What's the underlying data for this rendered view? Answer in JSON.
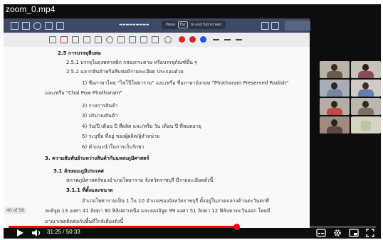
{
  "player": {
    "title": "zoom_0.mp4",
    "time_current": "31:25",
    "time_separator": "/",
    "time_total": "50:33",
    "progress": 0.621
  },
  "pdf_app": {
    "fullscreen_hint_pre": "Press",
    "fullscreen_hint_key": "Esc",
    "fullscreen_hint_post": "to exit full screen",
    "page_count": "40 of 58"
  },
  "document": {
    "lines": [
      "2.5 การบรรจุหีบห่อ",
      "2.5.1 บรรจุในถุงพลาสติก กล่องกระดาษ หรือบรรจุภัณฑ์อื่น ๆ",
      "2.5.2 ฉลากสินค้าหรือหีบห่อมีรายละเอียด ประกอบด้วย",
      "1) ชื่อภาษาไทย \"ไชโป๊โพธาราม\" และ/หรือ ชื่อภาษาอังกฤษ \"Photharam Preserved Radish\"",
      "และ/หรือ \"Chai Pow Photharam\"",
      "2) รายการสินค้า",
      "3) ปริมาณสินค้า",
      "4) วัน/ปี เดือน ปี ที่ผลิต และ/หรือ วัน เดือน ปี ที่หมดอายุ",
      "5) ระบุชื่อ ที่อยู่ ของผู้ผลิต/ผู้จำหน่าย",
      "6) คำแนะนำในการเก็บรักษา",
      "3. ความสัมพันธ์ระหว่างสินค้ากับแหล่งภูมิศาสตร์",
      "3.1 ลักษณะภูมิประเทศ",
      "สภาพภูมิศาสตร์ของอำเภอโพธาราม จังหวัดราชบุรี มีรายละเอียดดังนี้",
      "3.1.1 ที่ตั้งและขนาด",
      "อำเภอโพธารามเป็น 1 ใน 10 อำเภอของจังหวัดราชบุรี ตั้งอยู่ในภาคกลางด้านตะวันตกที่",
      "ละติจูด 13 องศา 41 ลิปดา 30 ฟิลิปดาเหนือ และลองจิจูด 99 องศา 51 ลิปดา 12 ฟิลิปดาตะวันออก โดยมี",
      "อาณาเขตติดต่อกับพื้นที่ใกล้เคียงดังนี้"
    ]
  },
  "colors": {
    "progress": "#ff0000",
    "app_bar": "#3c4a66",
    "annot_red": "#e02424",
    "annot_blue": "#2152e0"
  },
  "icons": {
    "play": "play-icon",
    "volume": "volume-icon",
    "subtitles": "subtitles-icon",
    "settings": "gear-icon",
    "miniplayer": "miniplayer-icon",
    "fullscreen": "fullscreen-icon"
  }
}
